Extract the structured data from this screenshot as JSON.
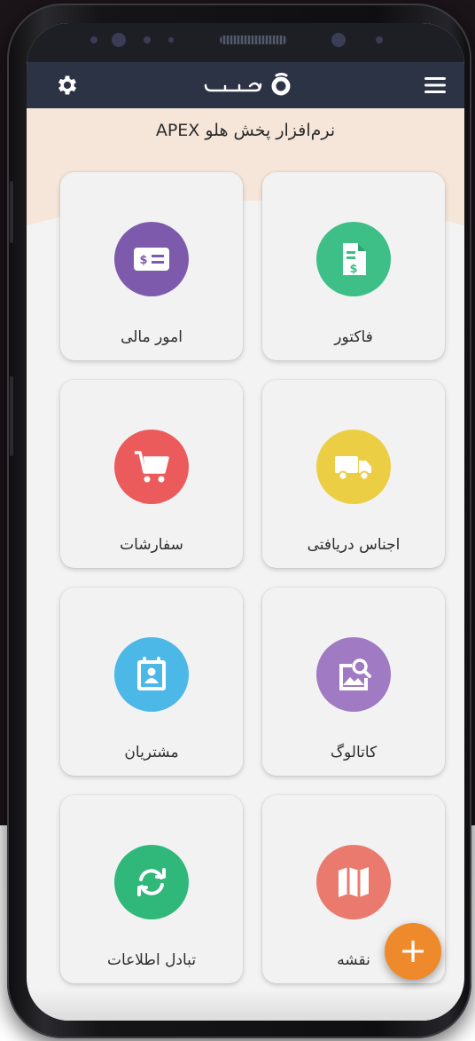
{
  "app": {
    "title": "نرم‌افزار پخش هلو APEX",
    "logo_text": "هلو"
  },
  "colors": {
    "appbar": "#2c3345",
    "banner": "#f5e6d9",
    "fab": "#ef8a2c"
  },
  "icons": {
    "settings": "gear-icon",
    "menu": "hamburger-menu-icon",
    "fab": "plus-icon"
  },
  "fab": {
    "label": "+"
  },
  "tiles": [
    {
      "label": "فاکتور",
      "icon": "invoice-icon",
      "color": "#3dbf87"
    },
    {
      "label": "امور مالی",
      "icon": "money-check-icon",
      "color": "#7e5aad"
    },
    {
      "label": "اجناس دریافتی",
      "icon": "delivery-truck-icon",
      "color": "#ecce45"
    },
    {
      "label": "سفارشات",
      "icon": "shopping-cart-icon",
      "color": "#ec5b5b"
    },
    {
      "label": "کاتالوگ",
      "icon": "image-search-icon",
      "color": "#a07ac2"
    },
    {
      "label": "مشتریان",
      "icon": "contact-book-icon",
      "color": "#4bb8e8"
    },
    {
      "label": "نقشه",
      "icon": "map-icon",
      "color": "#ea7a6e"
    },
    {
      "label": "تبادل اطلاعات",
      "icon": "sync-icon",
      "color": "#2fb87a"
    }
  ]
}
